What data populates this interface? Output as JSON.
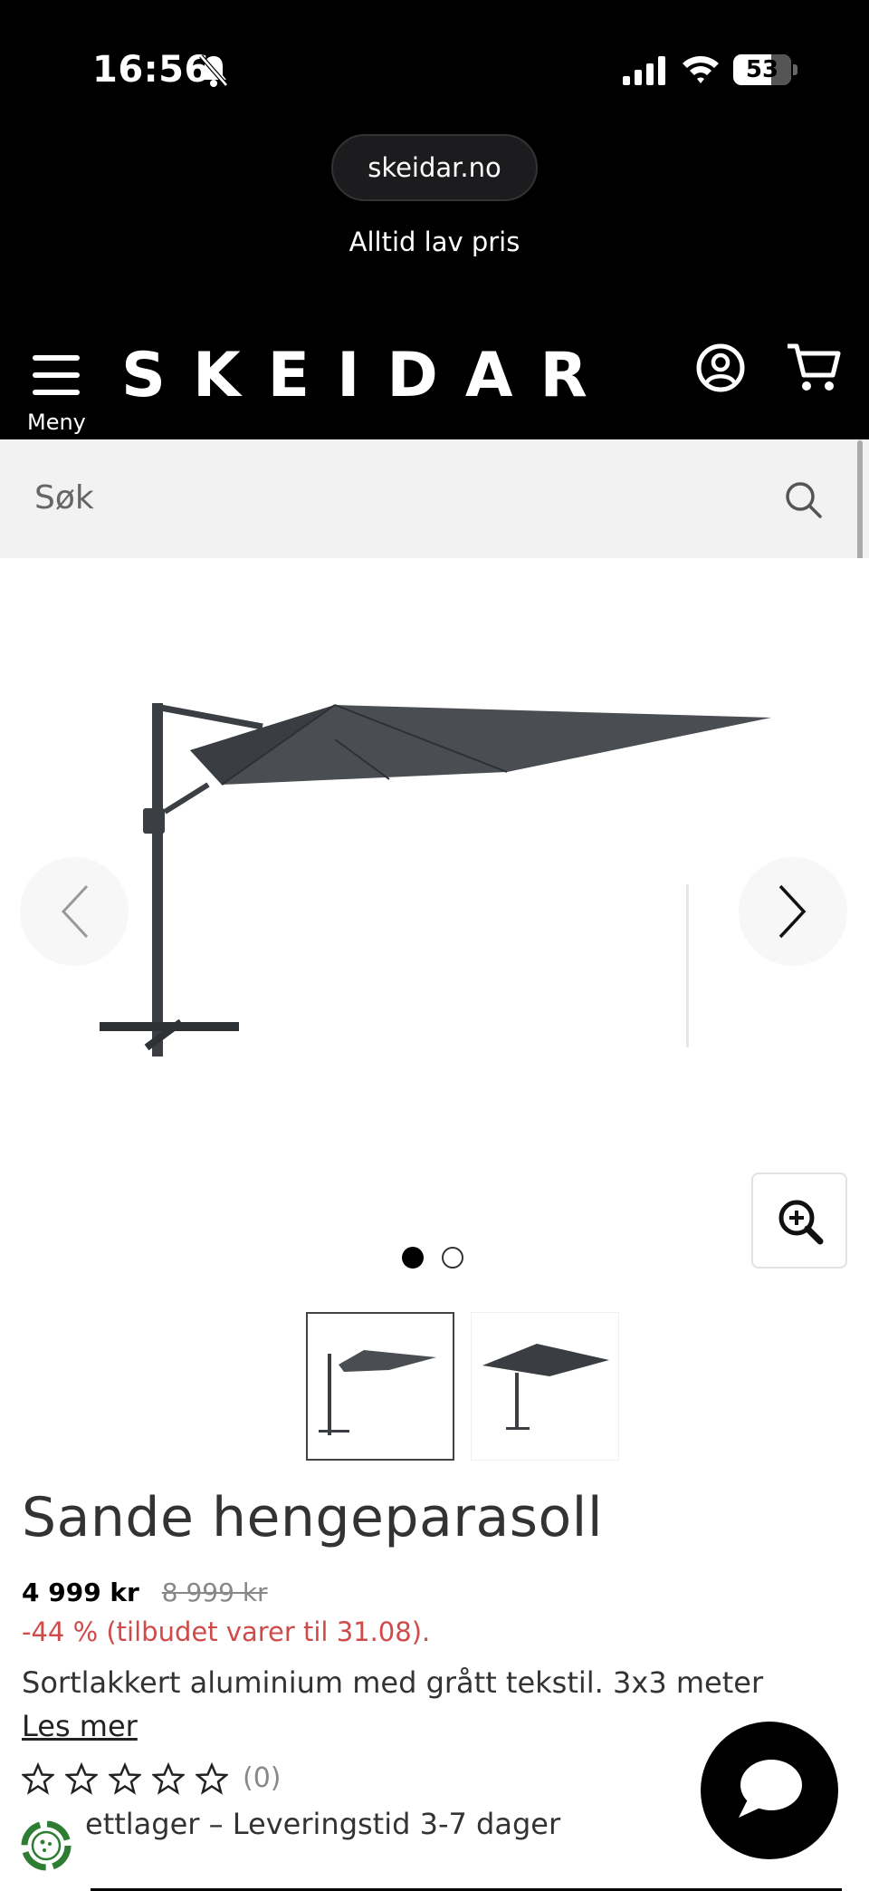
{
  "status_bar": {
    "time": "16:56",
    "battery": "53"
  },
  "browser": {
    "url": "skeidar.no",
    "tagline": "Alltid lav pris"
  },
  "header": {
    "menu_label": "Meny",
    "logo": "SKEIDAR"
  },
  "search": {
    "placeholder": "Søk"
  },
  "carousel": {
    "slide_count": 2,
    "active_slide": 1
  },
  "product": {
    "title": "Sande hengeparasoll",
    "price": "4 999 kr",
    "old_price": "8 999 kr",
    "discount": "-44 % (tilbudet varer til 31.08).",
    "description": "Sortlakkert aluminium med grått tekstil. 3x3 meter",
    "read_more": "Les mer",
    "rating_stars": 0,
    "rating_count": "(0)",
    "stock": "ettlager – Leveringstid 3-7 dager"
  },
  "colors": {
    "header_bg": "#000000",
    "discount": "#d04a4a",
    "search_bg": "#f2f2f2"
  }
}
